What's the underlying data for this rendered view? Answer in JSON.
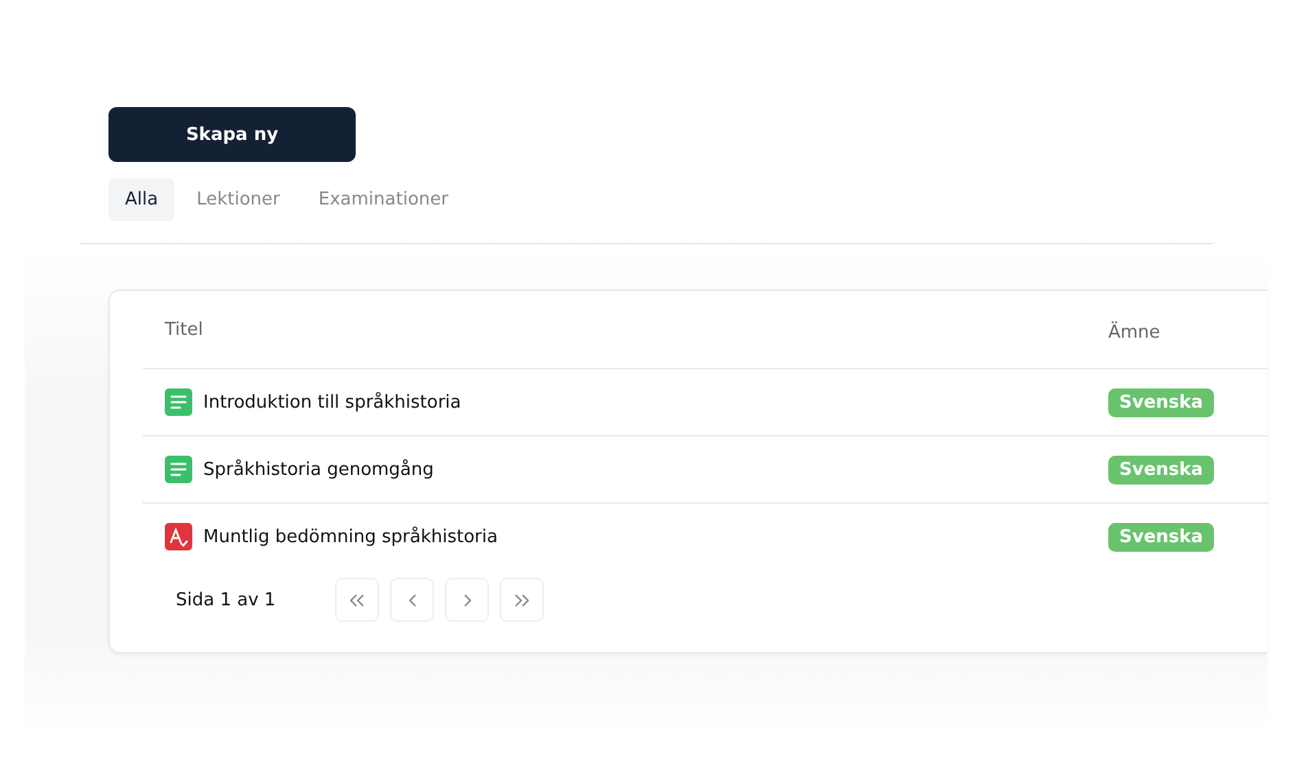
{
  "create_button": "Skapa ny",
  "tabs": [
    {
      "label": "Alla",
      "selected": true
    },
    {
      "label": "Lektioner",
      "selected": false
    },
    {
      "label": "Examinationer",
      "selected": false
    }
  ],
  "table": {
    "columns": [
      "Titel",
      "Ämne"
    ],
    "rows": [
      {
        "kind": "lesson",
        "title": "Introduktion till språkhistoria",
        "subject": "Svenska"
      },
      {
        "kind": "lesson",
        "title": "Språkhistoria genomgång",
        "subject": "Svenska"
      },
      {
        "kind": "exam",
        "title": "Muntlig bedömning språkhistoria",
        "subject": "Svenska"
      }
    ]
  },
  "pagination": {
    "label": "Sida 1 av 1"
  }
}
